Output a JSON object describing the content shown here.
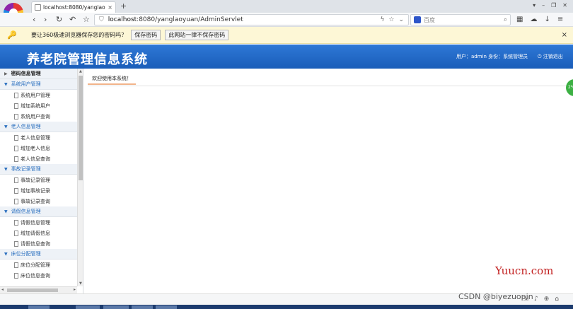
{
  "browser": {
    "tab_title": "localhost:8080/yanglaoyu",
    "tab_close": "×",
    "new_tab": "+",
    "url_host": "localhost",
    "url_rest": ":8080/yanglaoyuan/AdminServlet",
    "search_placeholder": "百度"
  },
  "password_bar": {
    "message": "要让360极速浏览器保存您的密码吗？",
    "save_label": "保存密码",
    "never_label": "此网站一律不保存密码",
    "close": "×"
  },
  "header": {
    "title": "养老院管理信息系统",
    "user_info": "用户：admin 身份：系统管理员",
    "logout": "注销退出"
  },
  "sidebar": {
    "groups": [
      {
        "label": "密码信息管理",
        "expanded": false,
        "items": []
      },
      {
        "label": "系统用户管理",
        "expanded": true,
        "items": [
          "系统用户管理",
          "增加系统用户",
          "系统用户查询"
        ]
      },
      {
        "label": "老人信息管理",
        "expanded": true,
        "items": [
          "老人信息管理",
          "增加老人信息",
          "老人信息查询"
        ]
      },
      {
        "label": "事故记录管理",
        "expanded": true,
        "items": [
          "事故记录管理",
          "增加事故记录",
          "事故记录查询"
        ]
      },
      {
        "label": "请假信息管理",
        "expanded": true,
        "items": [
          "请假信息管理",
          "增加请假信息",
          "请假信息查询"
        ]
      },
      {
        "label": "床位分配管理",
        "expanded": true,
        "items": [
          "床位分配管理",
          "床位信息查询"
        ]
      }
    ]
  },
  "main": {
    "welcome_tab": "欢迎使用本系统！"
  },
  "badge": {
    "text": "2%"
  },
  "watermarks": {
    "site": "Yuucn.com",
    "csdn": "CSDN @biyezuopin"
  },
  "colors": {
    "header_blue": "#1a5db9",
    "sidebar_group_text": "#2a6fbf",
    "pwbar_bg": "#fdf7d6"
  }
}
